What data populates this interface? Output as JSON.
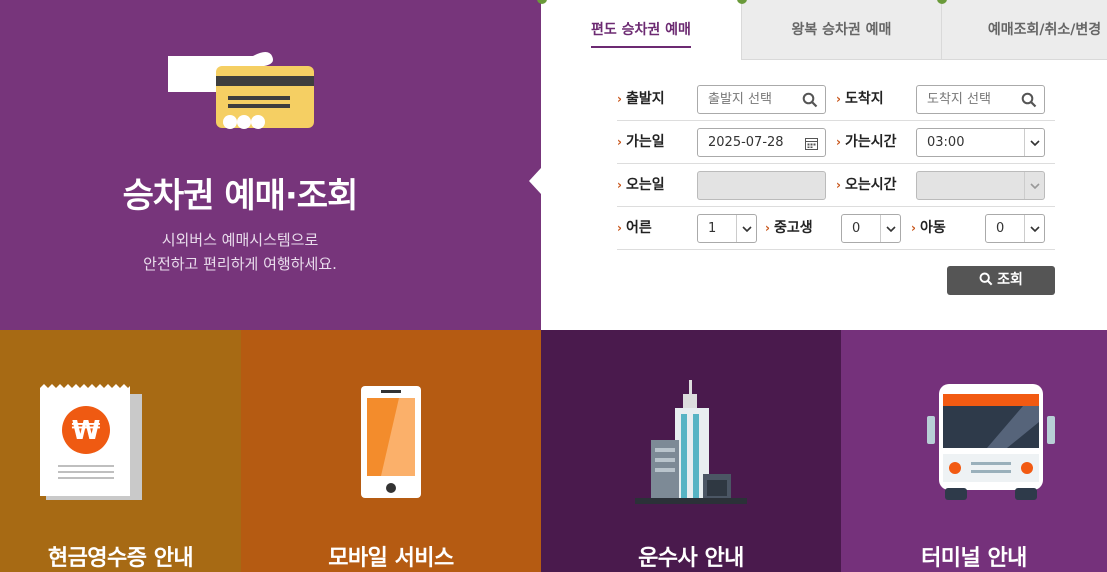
{
  "hero": {
    "title": "승차권 예매·조회",
    "subtitle_line1": "시외버스 예매시스템으로",
    "subtitle_line2": "안전하고 편리하게 여행하세요."
  },
  "tabs": [
    {
      "label": "편도 승차권 예매",
      "active": true
    },
    {
      "label": "왕복 승차권 예매",
      "active": false
    },
    {
      "label": "예매조회/취소/변경",
      "active": false
    }
  ],
  "form": {
    "departure": {
      "label": "출발지",
      "placeholder": "출발지 선택",
      "icon": "search-icon"
    },
    "arrival": {
      "label": "도착지",
      "placeholder": "도착지 선택",
      "icon": "search-icon"
    },
    "go_date": {
      "label": "가는일",
      "value": "2025-07-28",
      "icon": "calendar-icon"
    },
    "go_time": {
      "label": "가는시간",
      "value": "03:00"
    },
    "return_date": {
      "label": "오는일",
      "value": ""
    },
    "return_time": {
      "label": "오는시간",
      "value": ""
    },
    "adult": {
      "label": "어른",
      "value": "1"
    },
    "youth": {
      "label": "중고생",
      "value": "0"
    },
    "child": {
      "label": "아동",
      "value": "0"
    }
  },
  "search_button": {
    "label": "조회",
    "icon": "search-icon"
  },
  "tiles": [
    {
      "label": "현금영수증 안내",
      "icon": "receipt-won-icon",
      "color": "#a76a14"
    },
    {
      "label": "모바일 서비스",
      "icon": "smartphone-icon",
      "color": "#b55b12"
    },
    {
      "label": "운수사 안내",
      "icon": "buildings-icon",
      "color": "#4a1a4d"
    },
    {
      "label": "터미널 안내",
      "icon": "bus-icon",
      "color": "#75317b"
    }
  ],
  "colors": {
    "hero_bg": "#77357b",
    "accent_purple": "#6c2a72",
    "chevron_orange": "#c8561b",
    "button_dark": "#555555"
  }
}
